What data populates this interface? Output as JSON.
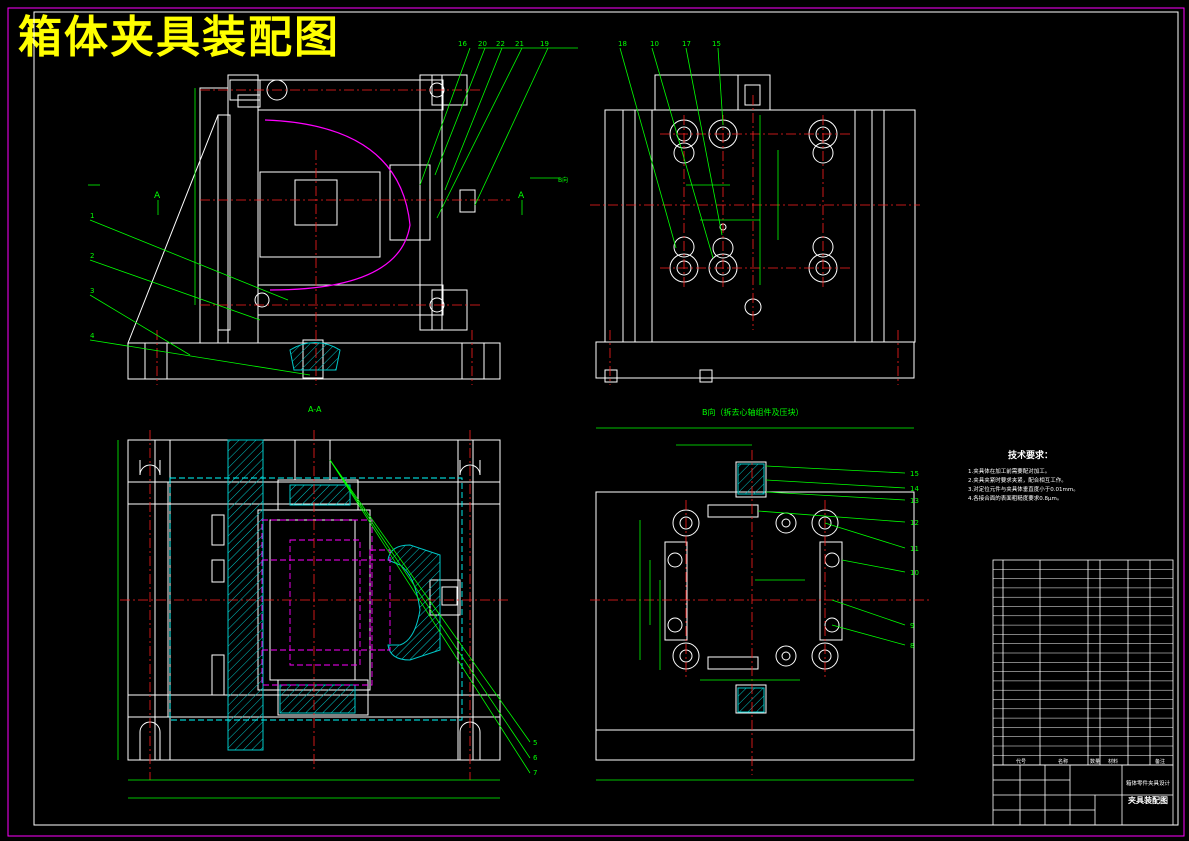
{
  "title": "箱体夹具装配图",
  "section_label": "A-A",
  "section_marker": "A",
  "view_b_label": "B向（拆去心轴组件及压块）",
  "view_b_arrow": "B向",
  "tech_req": {
    "heading": "技术要求：",
    "lines": [
      "1.夹具体在加工前需要配对加工。",
      "2.夹具夹紧时要求夹紧，配合相互工作。",
      "3.对定位元件与夹具体垂直度小于0.01mm。",
      "4.各接合面的表面粗糙度要求0.8μm。"
    ]
  },
  "balloons_front": [
    "16",
    "20",
    "22",
    "21",
    "19"
  ],
  "balloons_left": [
    "1",
    "2",
    "3",
    "4"
  ],
  "balloons_side": [
    "18",
    "10",
    "17",
    "15"
  ],
  "balloons_b": [
    "15",
    "14",
    "13",
    "12",
    "11",
    "10",
    "9",
    "8"
  ],
  "balloons_section": [
    "5",
    "6",
    "7"
  ],
  "title_block": {
    "drawing_name": "夹具装配图",
    "subtitle": "箱体零件夹具设计",
    "part_col": "代号",
    "name_col": "名称",
    "qty_col": "数量",
    "material_col": "材料",
    "notes_col": "备注"
  },
  "colors": {
    "outline": "#ffffff",
    "center": "#ff2020",
    "annot": "#00ff00",
    "hidden": "#00ffff",
    "hidden2": "#ff00ff",
    "title": "#ffff00",
    "hatch": "#00d0d0"
  }
}
